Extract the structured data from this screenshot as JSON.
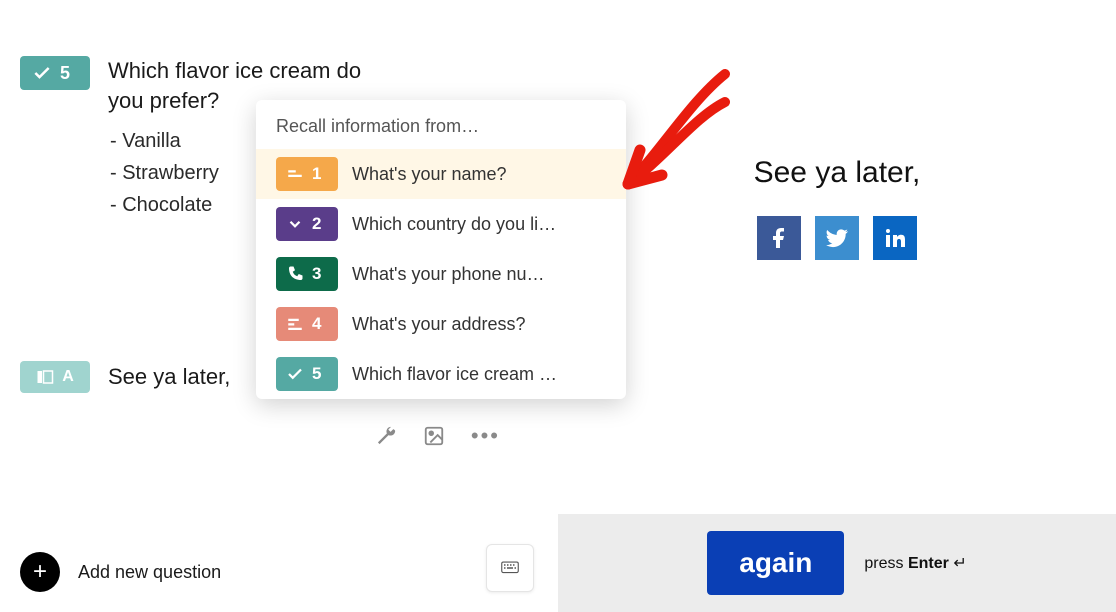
{
  "question": {
    "number": "5",
    "text": "Which flavor ice cream do you prefer?",
    "options": [
      "Vanilla",
      "Strawberry",
      "Chocolate"
    ]
  },
  "end_screen": {
    "badge_letter": "A",
    "text": "See ya later,"
  },
  "add_button_label": "Add new question",
  "recall": {
    "title": "Recall information from…",
    "items": [
      {
        "num": "1",
        "label": "What's your name?"
      },
      {
        "num": "2",
        "label": "Which country do you li…"
      },
      {
        "num": "3",
        "label": "What's your phone nu…"
      },
      {
        "num": "4",
        "label": "What's your address?"
      },
      {
        "num": "5",
        "label": "Which flavor ice cream …"
      }
    ]
  },
  "preview": {
    "heading": "See ya later,",
    "button_label": "again",
    "press_prefix": "press ",
    "press_key": "Enter",
    "press_suffix": " ↵"
  }
}
